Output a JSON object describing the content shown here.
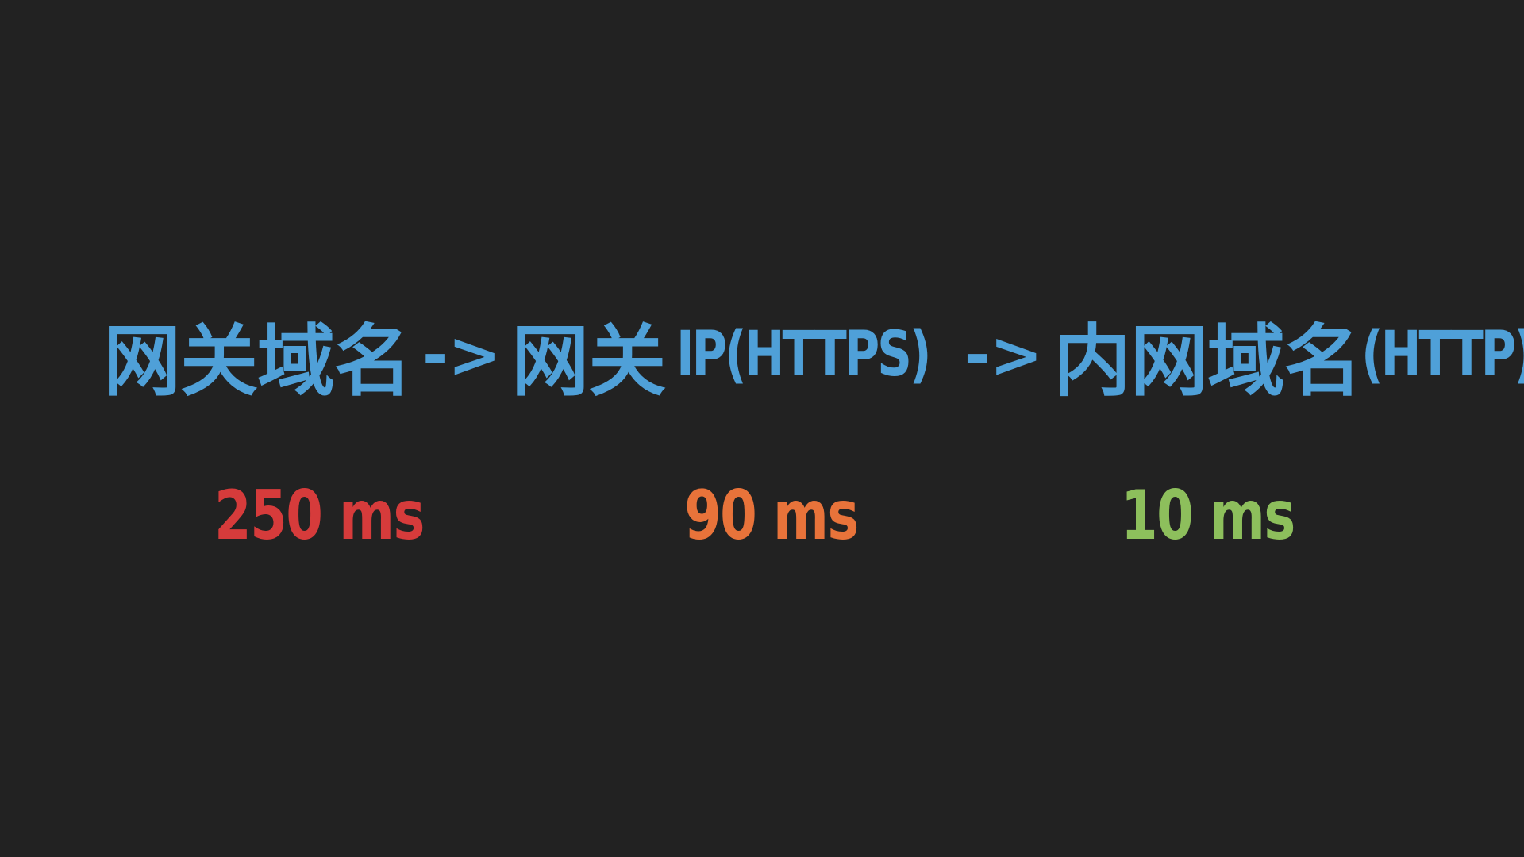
{
  "heading": {
    "part1": "网关域名",
    "arrow1": "->",
    "part2_cjk": "网关",
    "part2_latin": "IP(HTTPS)",
    "arrow2": "->",
    "part3_cjk": "内网域名",
    "part3_latin": "(HTTP)",
    "color": "#4fa0d8"
  },
  "timings": [
    {
      "label": "250 ms",
      "color": "#d63b3b"
    },
    {
      "label": "90 ms",
      "color": "#e8733a"
    },
    {
      "label": "10 ms",
      "color": "#8dbf5c"
    }
  ],
  "background": "#222222"
}
